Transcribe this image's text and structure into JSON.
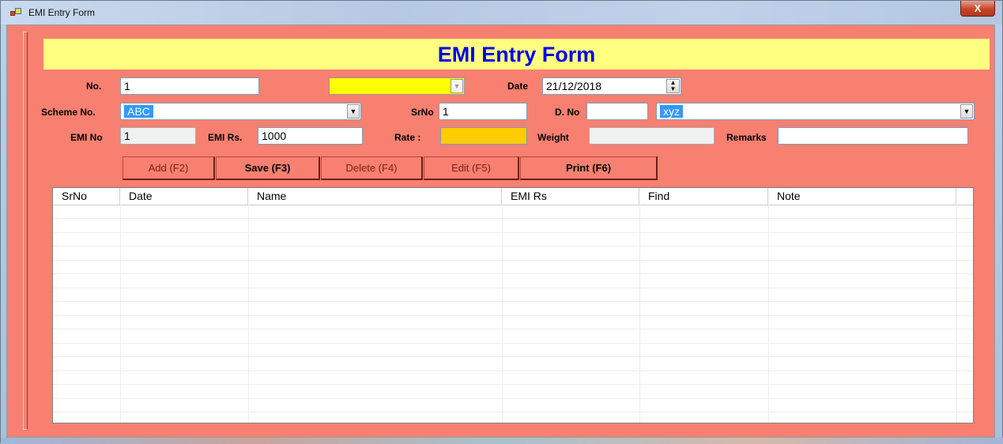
{
  "window": {
    "title": "EMI Entry Form",
    "close_label": "X"
  },
  "banner": {
    "title": "EMI Entry Form"
  },
  "form": {
    "no_label": "No.",
    "no_value": "1",
    "date_label": "Date",
    "date_value": "21/12/2018",
    "scheme_no_label": "Scheme No.",
    "scheme_no_value": "ABC",
    "srno_label": "SrNo",
    "srno_value": "1",
    "dno_label": "D. No",
    "dno_value": "",
    "party_value": "xyz",
    "emi_no_label": "EMI No",
    "emi_no_value": "1",
    "emi_rs_label": "EMI Rs.",
    "emi_rs_value": "1000",
    "rate_label": "Rate :",
    "rate_value": "",
    "weight_label": "Weight",
    "weight_value": "",
    "remarks_label": "Remarks",
    "remarks_value": ""
  },
  "toolbar": {
    "add_label": "Add (F2)",
    "save_label": "Save (F3)",
    "delete_label": "Delete (F4)",
    "edit_label": "Edit (F5)",
    "print_label": "Print (F6)"
  },
  "grid": {
    "columns": [
      "SrNo",
      "Date",
      "Name",
      "EMI Rs",
      "Find",
      "Note"
    ],
    "rows": []
  },
  "colors": {
    "form_background": "#f88070",
    "banner_background": "#ffff80",
    "banner_text": "#0000ee",
    "highlight_combo": "#ffff00",
    "rate_field": "#ffcc00",
    "selection": "#3399ff"
  },
  "icons": {
    "app": "form-window-icon",
    "dropdown": "chevron-down-icon",
    "spinner": "spin-updown-icon"
  }
}
